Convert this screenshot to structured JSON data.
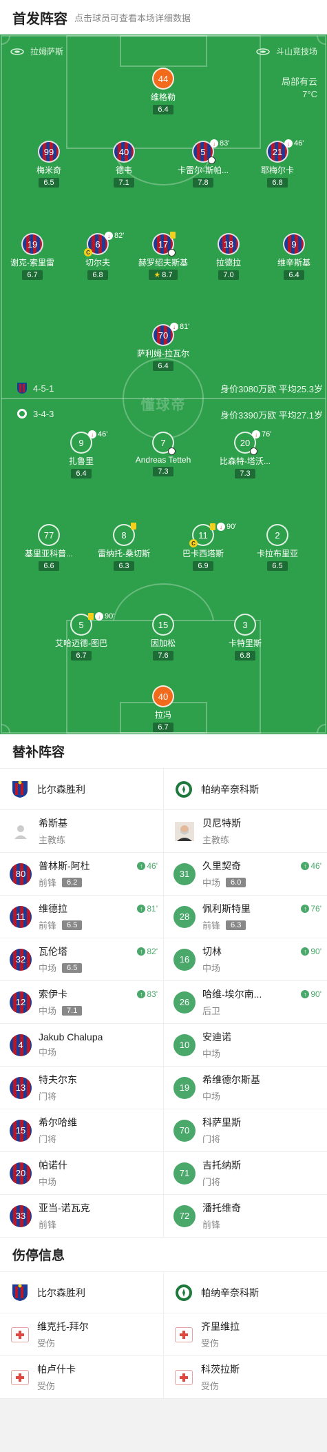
{
  "header": {
    "title": "首发阵容",
    "subtitle": "点击球员可查看本场详细数据"
  },
  "pitch": {
    "home_team": "拉姆萨斯",
    "away_team": "斗山竞技场",
    "weather": "局部有云",
    "temperature": "7°C",
    "watermark": "懂球帝",
    "home_formation": "4-5-1",
    "home_value": "身价3080万欧 平均25.3岁",
    "away_formation": "3-4-3",
    "away_value": "身价3390万欧 平均27.1岁",
    "players": [
      {
        "num": "44",
        "name": "维格勒",
        "rating": "6.4",
        "kit": "gk"
      },
      {
        "num": "99",
        "name": "梅米奇",
        "rating": "6.5",
        "kit": "home"
      },
      {
        "num": "40",
        "name": "德韦",
        "rating": "7.1",
        "kit": "home"
      },
      {
        "num": "5",
        "name": "卡雷尔-斯帕...",
        "rating": "7.8",
        "kit": "home",
        "sub_min": "83'"
      },
      {
        "num": "21",
        "name": "耶梅尔卡",
        "rating": "6.8",
        "kit": "home",
        "sub_min": "46'"
      },
      {
        "num": "19",
        "name": "谢克-索里雷",
        "rating": "6.7",
        "kit": "home"
      },
      {
        "num": "6",
        "name": "切尔夫",
        "rating": "6.8",
        "kit": "home",
        "sub_min": "82'"
      },
      {
        "num": "17",
        "name": "赫罗绍夫斯基",
        "rating": "8.7",
        "kit": "home"
      },
      {
        "num": "18",
        "name": "拉德拉",
        "rating": "7.0",
        "kit": "home"
      },
      {
        "num": "9",
        "name": "维辛斯基",
        "rating": "6.4",
        "kit": "home"
      },
      {
        "num": "70",
        "name": "萨利姆-拉瓦尔",
        "rating": "6.4",
        "kit": "home",
        "sub_min": "81'"
      },
      {
        "num": "9",
        "name": "扎鲁里",
        "rating": "6.4",
        "kit": "away",
        "sub_min": "46'"
      },
      {
        "num": "7",
        "name": "Andreas Tetteh",
        "rating": "7.3",
        "kit": "away"
      },
      {
        "num": "20",
        "name": "比森特-塔沃...",
        "rating": "7.3",
        "kit": "away",
        "sub_min": "76'"
      },
      {
        "num": "77",
        "name": "基里亚科普...",
        "rating": "6.6",
        "kit": "away"
      },
      {
        "num": "8",
        "name": "雷纳托-桑切斯",
        "rating": "6.3",
        "kit": "away"
      },
      {
        "num": "11",
        "name": "巴卡西塔斯",
        "rating": "6.9",
        "kit": "away",
        "sub_min": "90'"
      },
      {
        "num": "2",
        "name": "卡拉布里亚",
        "rating": "6.5",
        "kit": "away"
      },
      {
        "num": "5",
        "name": "艾哈迈德-图巴",
        "rating": "6.7",
        "kit": "away",
        "sub_min": "90'"
      },
      {
        "num": "15",
        "name": "因加松",
        "rating": "7.6",
        "kit": "away"
      },
      {
        "num": "3",
        "name": "卡特里斯",
        "rating": "6.8",
        "kit": "away"
      },
      {
        "num": "40",
        "name": "拉冯",
        "rating": "6.7",
        "kit": "gk"
      }
    ]
  },
  "subs": {
    "title": "替补阵容",
    "home_team": "比尔森胜利",
    "away_team": "帕纳辛奈科斯",
    "home_coach": {
      "name": "希斯基",
      "role": "主教练"
    },
    "away_coach": {
      "name": "贝尼特斯",
      "role": "主教练"
    },
    "home": [
      {
        "num": "80",
        "name": "普林斯-阿杜",
        "pos": "前锋",
        "rating": "6.2",
        "in": "46'"
      },
      {
        "num": "11",
        "name": "维德拉",
        "pos": "前锋",
        "rating": "6.5",
        "in": "81'"
      },
      {
        "num": "32",
        "name": "瓦伦塔",
        "pos": "中场",
        "rating": "6.5",
        "in": "82'"
      },
      {
        "num": "12",
        "name": "索伊卡",
        "pos": "中场",
        "rating": "7.1",
        "in": "83'"
      },
      {
        "num": "4",
        "name": "Jakub Chalupa",
        "pos": "中场"
      },
      {
        "num": "13",
        "name": "特夫尔东",
        "pos": "门将"
      },
      {
        "num": "15",
        "name": "希尔哈维",
        "pos": "门将"
      },
      {
        "num": "20",
        "name": "帕诺什",
        "pos": "中场"
      },
      {
        "num": "33",
        "name": "亚当-诺瓦克",
        "pos": "前锋"
      }
    ],
    "away": [
      {
        "num": "31",
        "name": "久里契奇",
        "pos": "中场",
        "rating": "6.0",
        "in": "46'"
      },
      {
        "num": "28",
        "name": "佩利斯特里",
        "pos": "前锋",
        "rating": "6.3",
        "in": "76'"
      },
      {
        "num": "16",
        "name": "切林",
        "pos": "中场",
        "in": "90'"
      },
      {
        "num": "26",
        "name": "哈维-埃尔南...",
        "pos": "后卫",
        "in": "90'"
      },
      {
        "num": "10",
        "name": "安迪诺",
        "pos": "中场"
      },
      {
        "num": "19",
        "name": "希维德尔斯基",
        "pos": "中场"
      },
      {
        "num": "70",
        "name": "科萨里斯",
        "pos": "门将"
      },
      {
        "num": "71",
        "name": "吉托纳斯",
        "pos": "门将"
      },
      {
        "num": "72",
        "name": "潘托维奇",
        "pos": "前锋"
      }
    ]
  },
  "injuries": {
    "title": "伤停信息",
    "home_team": "比尔森胜利",
    "away_team": "帕纳辛奈科斯",
    "home": [
      {
        "name": "维克托-拜尔",
        "status": "受伤"
      },
      {
        "name": "帕卢什卡",
        "status": "受伤"
      }
    ],
    "away": [
      {
        "name": "齐里维拉",
        "status": "受伤"
      },
      {
        "name": "科茨拉斯",
        "status": "受伤"
      }
    ]
  },
  "colors": {
    "pitch": "#2ea04b",
    "gk": "#f26b1d",
    "home_blue": "#1f3a93",
    "home_red": "#b3192b"
  }
}
